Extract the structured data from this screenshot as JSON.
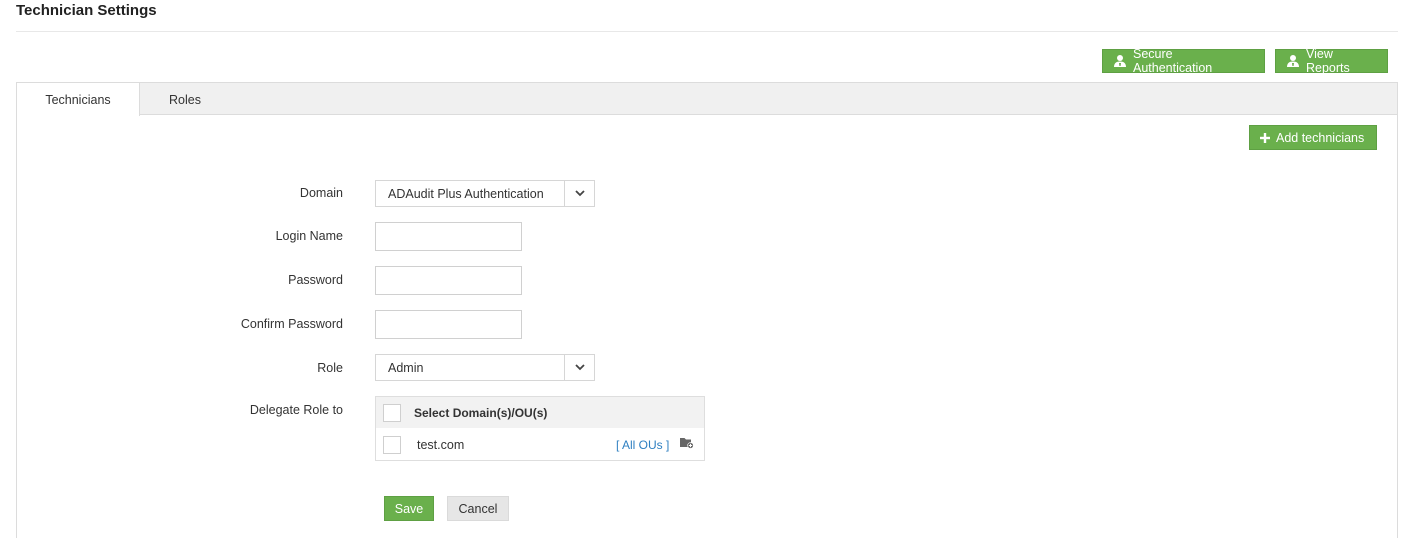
{
  "page": {
    "title": "Technician Settings"
  },
  "toolbar": {
    "secure_auth_label": "Secure Authentication",
    "view_reports_label": "View Reports"
  },
  "tabs": [
    {
      "label": "Technicians",
      "active": true
    },
    {
      "label": "Roles",
      "active": false
    }
  ],
  "actions": {
    "add_technicians_label": "Add technicians"
  },
  "form": {
    "domain": {
      "label": "Domain",
      "value": "ADAudit Plus Authentication"
    },
    "login_name": {
      "label": "Login Name",
      "value": ""
    },
    "password": {
      "label": "Password",
      "value": ""
    },
    "confirm_password": {
      "label": "Confirm Password",
      "value": ""
    },
    "role": {
      "label": "Role",
      "value": "Admin"
    },
    "delegate": {
      "label": "Delegate Role to",
      "header": "Select Domain(s)/OU(s)",
      "rows": [
        {
          "domain": "test.com",
          "ous_link": "[ All OUs ]",
          "checked": false
        }
      ]
    },
    "save_label": "Save",
    "cancel_label": "Cancel"
  },
  "colors": {
    "accent_green": "#6ab04c",
    "link_blue": "#2e7fc1",
    "tab_bar_bg": "#f0f0f0"
  },
  "icons": {
    "secure_auth": "user-shield-icon",
    "view_reports": "user-report-icon",
    "add": "plus-icon",
    "dropdown": "chevron-down-icon",
    "ou_picker": "folder-add-icon"
  }
}
